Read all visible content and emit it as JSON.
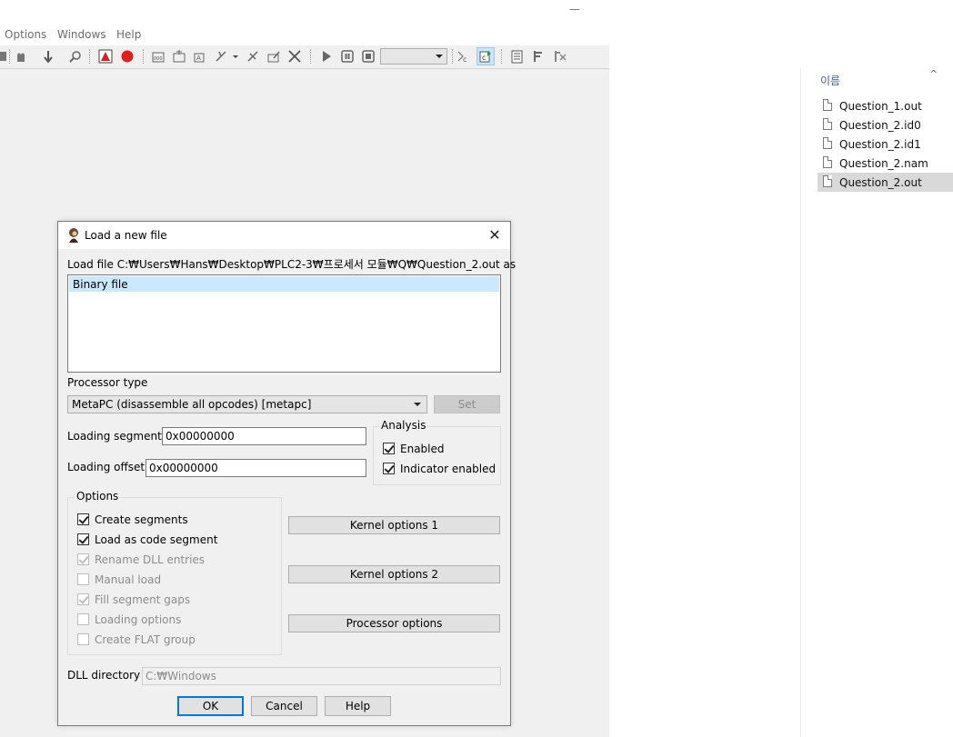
{
  "app": {
    "menu": [
      "Options",
      "Windows",
      "Help"
    ],
    "minimize_glyph": "—"
  },
  "toolbar_icons": [
    "debugger-icon",
    "hand-icon",
    "arrow-down-icon",
    "search-icon",
    "alert-icon",
    "record-icon",
    "code-icon",
    "data-icon",
    "align-icon",
    "structure-icon",
    "dropdown-icon",
    "plugin-icon",
    "edit-icon",
    "close-x-icon",
    "play-icon",
    "pause-icon",
    "stop-icon",
    "module-icon",
    "cursor-icon",
    "script-icon",
    "attach-icon",
    "detach-icon"
  ],
  "explorer": {
    "column_header": "이름",
    "sort_glyph": "^",
    "files": [
      {
        "name": "Question_1.out",
        "selected": false
      },
      {
        "name": "Question_2.id0",
        "selected": false
      },
      {
        "name": "Question_2.id1",
        "selected": false
      },
      {
        "name": "Question_2.nam",
        "selected": false
      },
      {
        "name": "Question_2.out",
        "selected": true
      }
    ]
  },
  "dialog": {
    "title": "Load a new file",
    "close_glyph": "✕",
    "load_file_label": "Load file C:₩Users₩Hans₩Desktop₩PLC2-3₩프로세서 모듈₩Q₩Question_2.out as",
    "file_types": [
      "Binary file"
    ],
    "processor_type_label": "Processor type",
    "processor_value": "MetaPC (disassemble all opcodes) [metapc]",
    "set_button": "Set",
    "loading_segment_label": "Loading segment",
    "loading_segment_value": "0x00000000",
    "loading_offset_label": "Loading offset",
    "loading_offset_value": "0x00000000",
    "analysis": {
      "title": "Analysis",
      "enabled": {
        "label": "Enabled",
        "checked": true
      },
      "indicator": {
        "label": "Indicator enabled",
        "checked": true
      }
    },
    "options": {
      "title": "Options",
      "items": [
        {
          "label": "Create segments",
          "checked": true,
          "disabled": false
        },
        {
          "label": "Load as code segment",
          "checked": true,
          "disabled": false
        },
        {
          "label": "Rename DLL entries",
          "checked": true,
          "disabled": true
        },
        {
          "label": "Manual load",
          "checked": false,
          "disabled": true
        },
        {
          "label": "Fill segment gaps",
          "checked": true,
          "disabled": true
        },
        {
          "label": "Loading options",
          "checked": false,
          "disabled": true
        },
        {
          "label": "Create FLAT group",
          "checked": false,
          "disabled": true
        }
      ]
    },
    "kernel_options_1": "Kernel options 1",
    "kernel_options_2": "Kernel options 2",
    "processor_options": "Processor options",
    "dll_directory_label": "DLL directory",
    "dll_directory_value": "C:₩Windows",
    "ok": "OK",
    "cancel": "Cancel",
    "help": "Help"
  }
}
